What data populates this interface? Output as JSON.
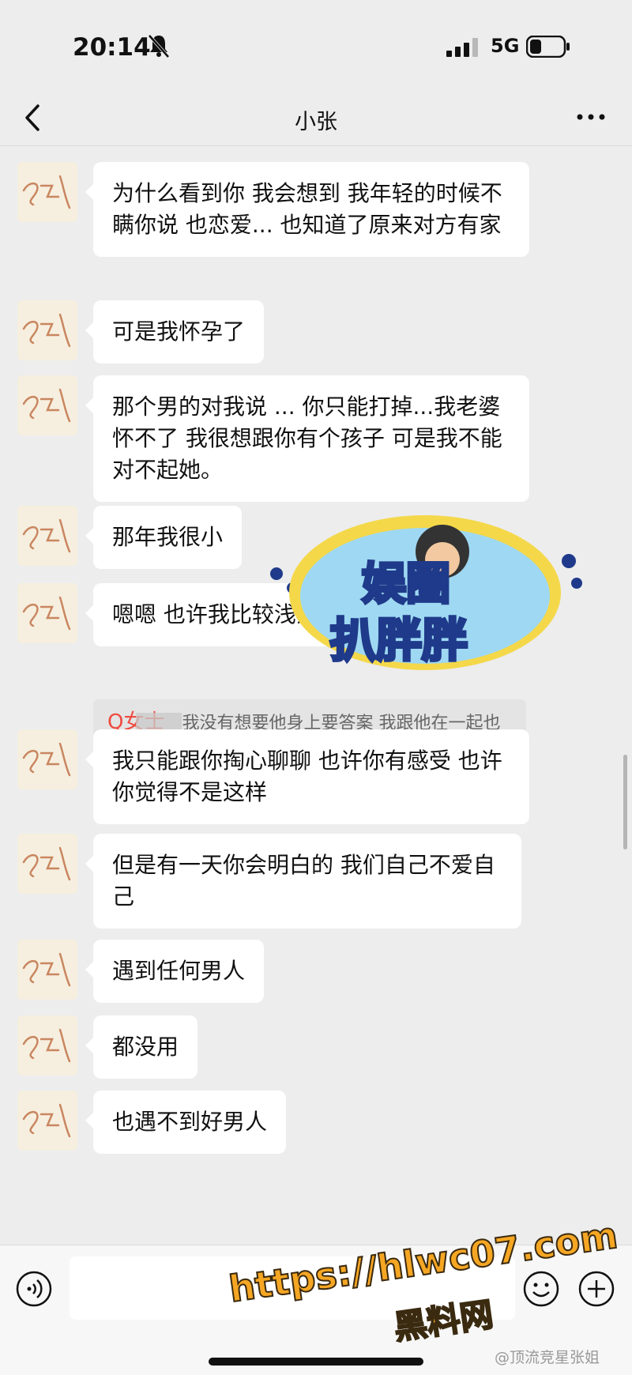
{
  "status_bar": {
    "time": "20:14",
    "network": "5G",
    "icons": [
      "bell-muted-icon",
      "signal-icon",
      "battery-icon"
    ]
  },
  "nav": {
    "title": "小张",
    "icons": [
      "back-icon",
      "more-icon"
    ]
  },
  "messages": [
    {
      "sender": "other",
      "text": "为什么看到你 我会想到 我年轻的时候不瞒你说 也恋爱... 也知道了原来对方有家"
    },
    {
      "sender": "other",
      "text": "可是我怀孕了"
    },
    {
      "sender": "other",
      "text": "那个男的对我说 ... 你只能打掉...我老婆怀不了 我很想跟你有个孩子 可是我不能对不起她。"
    },
    {
      "sender": "other",
      "text": "那年我很小"
    },
    {
      "sender": "other",
      "text": "嗯嗯 也许我比较浅薄"
    },
    {
      "sender": "other",
      "text": "我只能跟你掏心聊聊 也许你有感受 也许你觉得不是这样"
    },
    {
      "sender": "other",
      "text": "但是有一天你会明白的 我们自己不爱自己"
    },
    {
      "sender": "other",
      "text": "遇到任何男人"
    },
    {
      "sender": "other",
      "text": "都没用"
    },
    {
      "sender": "other",
      "text": "也遇不到好男人"
    }
  ],
  "quote": {
    "name": "Q女士",
    "text": "我没有想要他身上要答案 我跟他在一起也不是因为我爸怎么怎么才导致我..."
  },
  "overlay_logo": {
    "line1": "娱圈",
    "line2": "扒胖胖"
  },
  "input_bar": {
    "placeholder": "",
    "icons": [
      "voice-icon",
      "emoji-icon",
      "plus-icon"
    ]
  },
  "watermarks": {
    "url": "https://hlwc07.com",
    "site": "黑料网",
    "weibo": "@顶流竞星张姐"
  },
  "colors": {
    "background": "#ededed",
    "bubble": "#ffffff",
    "quote_name": "#ef4b3f",
    "watermark": "#f5a623"
  }
}
